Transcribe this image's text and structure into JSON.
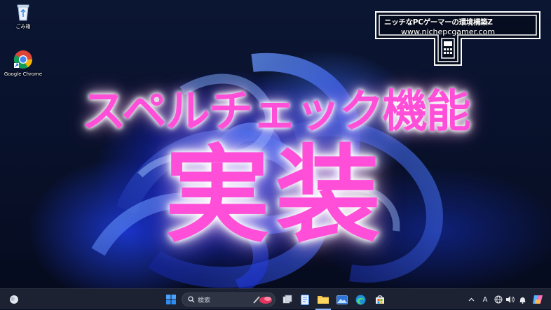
{
  "desktop": {
    "icons": [
      {
        "label": "ごみ箱",
        "icon": "recycle-bin-icon"
      },
      {
        "label": "Google Chrome",
        "icon": "chrome-icon"
      }
    ]
  },
  "headline": {
    "line1": "スペルチェック機能",
    "line2": "実装"
  },
  "logo": {
    "title": "ニッチなPCゲーマーの環境構築Z",
    "url": "www.nichepcgamer.com"
  },
  "taskbar": {
    "search_placeholder": "検索",
    "ime_indicator": "A",
    "pinned_apps": [
      "start-icon",
      "task-view-icon",
      "file-explorer-icon",
      "notepad-icon",
      "folder-icon",
      "photos-icon",
      "edge-icon",
      "store-icon"
    ]
  },
  "colors": {
    "headline": "#ff4fd8",
    "taskbar": "#1c2231",
    "accent": "#3a6cff"
  }
}
